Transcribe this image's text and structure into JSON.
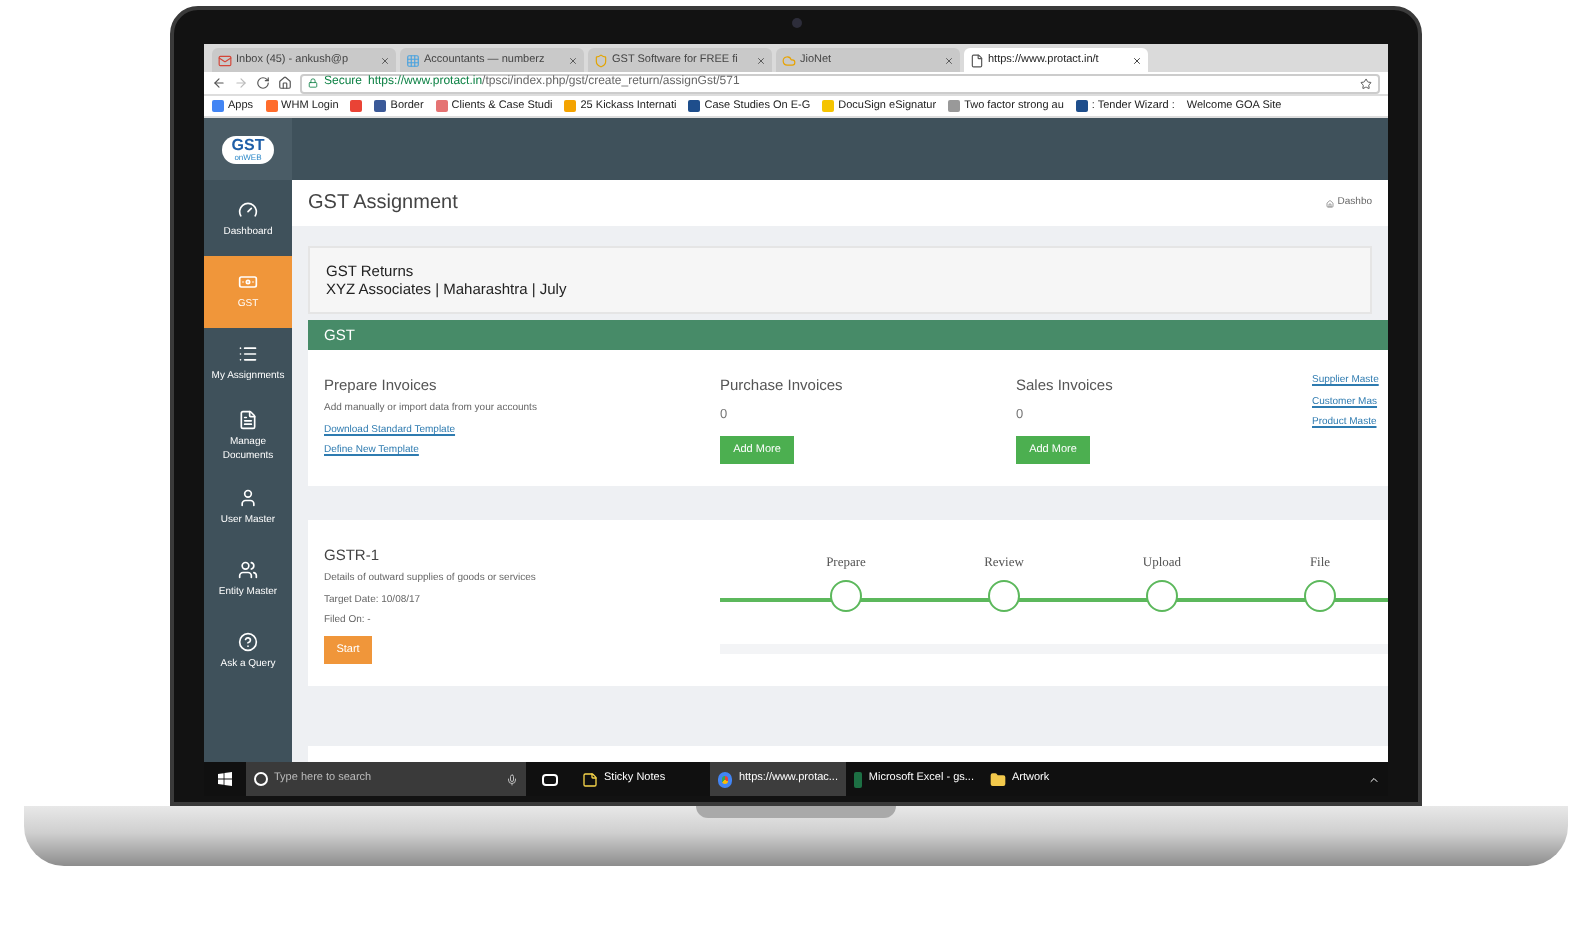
{
  "browser": {
    "tabs": [
      {
        "label": "Inbox (45) - ankush@p",
        "kind": "mail",
        "selected": false
      },
      {
        "label": "Accountants — numberz",
        "kind": "site",
        "selected": false
      },
      {
        "label": "GST Software for FREE fi",
        "kind": "shield",
        "selected": false
      },
      {
        "label": "JioNet",
        "kind": "cloud",
        "selected": false
      },
      {
        "label": "https://www.protact.in/t",
        "kind": "page",
        "selected": true
      }
    ],
    "secure_label": "Secure",
    "url_host": "https://www.protact.in",
    "url_path": "/tpsci/index.php/gst/create_return/assignGst/571",
    "bookmarks": [
      {
        "label": "Apps",
        "kind": "grid"
      },
      {
        "label": "WHM Login",
        "kind": "cp"
      },
      {
        "kind": "google"
      },
      {
        "label": "Border",
        "kind": "fb"
      },
      {
        "label": "Clients & Case Studi",
        "kind": "doc"
      },
      {
        "label": "25 Kickass Internati",
        "kind": "fire"
      },
      {
        "label": "Case Studies On E-G",
        "kind": "blue"
      },
      {
        "label": "DocuSign eSignatur",
        "kind": "docu"
      },
      {
        "label": "Two factor strong au",
        "kind": "page"
      },
      {
        "label": ": Tender Wizard :",
        "kind": "blue"
      },
      {
        "label": "Welcome GOA Site",
        "kind": "none"
      }
    ]
  },
  "logo": {
    "title": "GST",
    "subtitle": "onWEB"
  },
  "sidebar": {
    "items": [
      {
        "label": "Dashboard",
        "kind": "gauge",
        "selected": false
      },
      {
        "label": "GST",
        "kind": "money",
        "selected": true
      },
      {
        "label": "My Assignments",
        "kind": "list",
        "selected": false
      },
      {
        "label": "Manage Documents",
        "kind": "doc",
        "selected": false
      },
      {
        "label": "User Master",
        "kind": "user",
        "selected": false
      },
      {
        "label": "Entity Master",
        "kind": "users",
        "selected": false
      },
      {
        "label": "Ask a Query",
        "kind": "question",
        "selected": false
      }
    ]
  },
  "page": {
    "title": "GST Assignment",
    "breadcrumb": "Dashbo",
    "returns_title": "GST Returns",
    "returns_subtitle": "XYZ Associates | Maharashtra | July",
    "section_title": "GST",
    "prepare": {
      "title": "Prepare Invoices",
      "description": "Add manually or import data from your accounts",
      "links": [
        "Download Standard Template",
        "Define New Template"
      ]
    },
    "invoice_columns": [
      {
        "title": "Purchase Invoices",
        "count": "0",
        "button": "Add More"
      },
      {
        "title": "Sales Invoices",
        "count": "0",
        "button": "Add More"
      }
    ],
    "master_links": [
      "Supplier Maste",
      "Customer Mas",
      "Product Maste"
    ],
    "gstr": {
      "title": "GSTR-1",
      "description": "Details of outward supplies of goods or services",
      "target_date": "Target Date: 10/08/17",
      "filed_on": "Filed On: -",
      "button": "Start",
      "steps": [
        "Prepare",
        "Review",
        "Upload",
        "File"
      ]
    }
  },
  "taskbar": {
    "search_placeholder": "Type here to search",
    "apps": [
      {
        "label": "Sticky Notes",
        "kind": "note",
        "selected": false
      },
      {
        "label": "https://www.protac...",
        "kind": "chrome",
        "selected": true
      },
      {
        "label": "Microsoft Excel - gs...",
        "kind": "excel",
        "selected": false
      },
      {
        "label": "Artwork",
        "kind": "folder",
        "selected": false
      }
    ]
  }
}
